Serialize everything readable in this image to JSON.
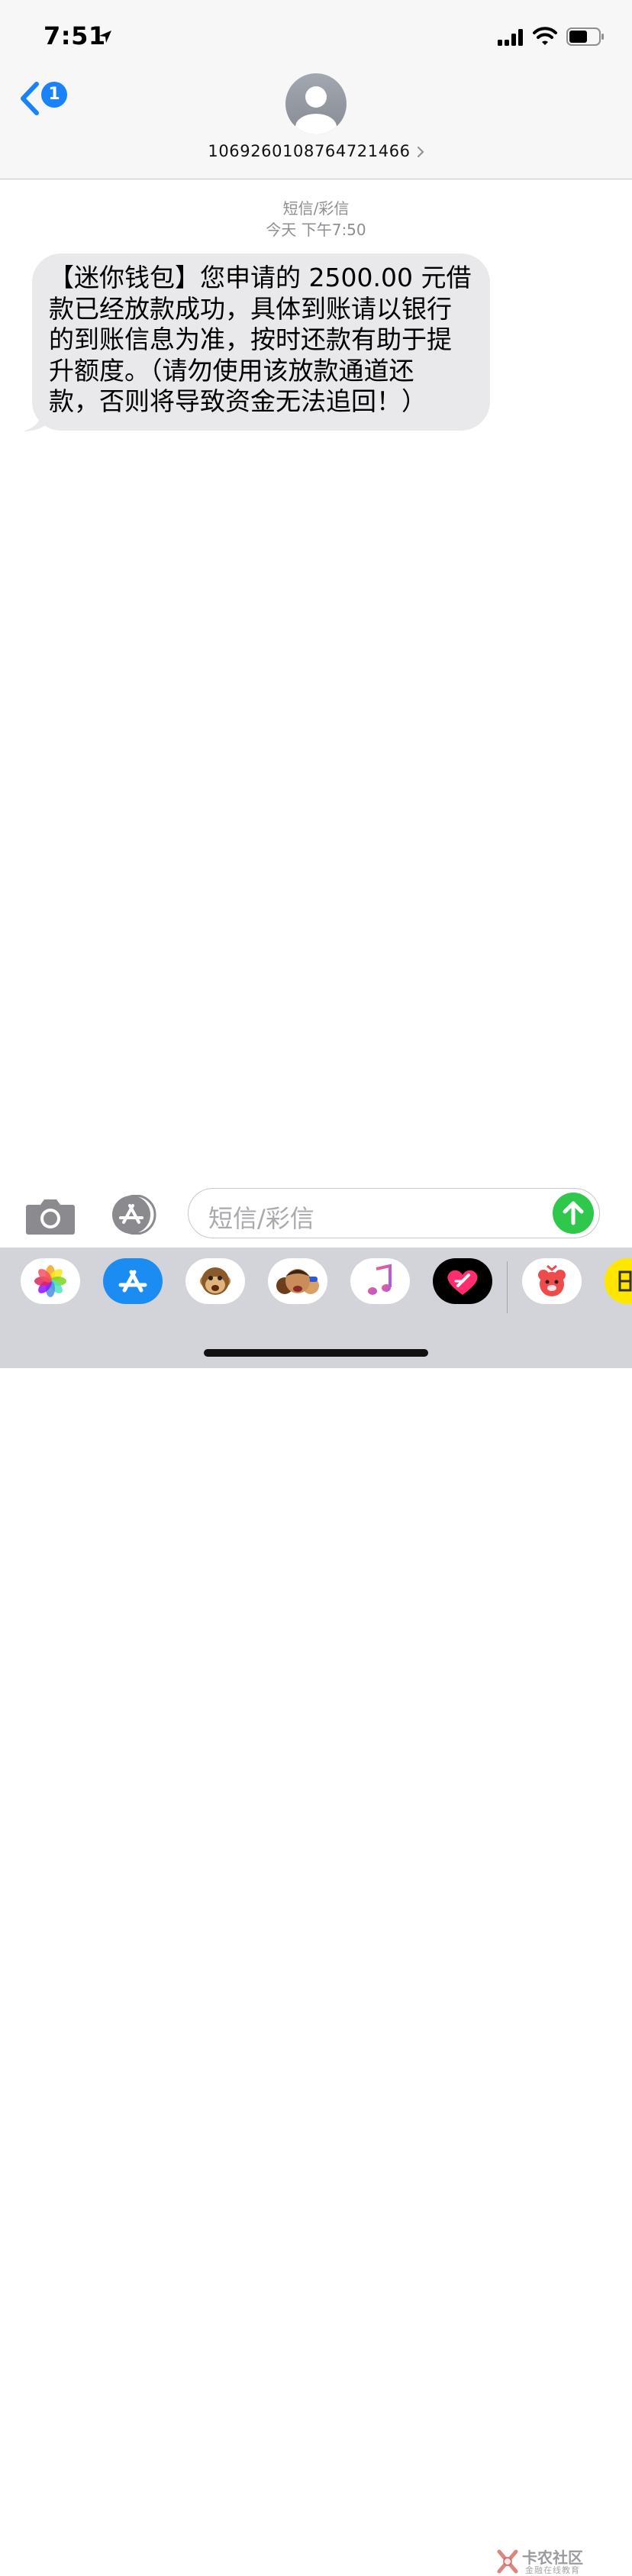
{
  "status_bar": {
    "time": "7:51",
    "battery_level": 0.6
  },
  "nav": {
    "back_badge": "1",
    "contact_number": "1069260108764721466"
  },
  "conversation": {
    "service_label": "短信/彩信",
    "timestamp": "今天 下午7:50",
    "messages": [
      {
        "direction": "incoming",
        "lines": [
          "【迷你钱包】您申请的 2500.00 元借",
          "款已经放款成功，具体到账请以银行",
          "的到账信息为准，按时还款有助于提",
          "升额度。（请勿使用该放款通道还",
          "款，否则将导致资金无法追回！）"
        ]
      }
    ]
  },
  "composer": {
    "placeholder": "短信/彩信"
  },
  "app_drawer": {
    "apps": [
      "photos-icon",
      "app-store-icon",
      "animoji-icon",
      "memoji-icon",
      "music-icon",
      "digital-touch-icon",
      "bear-app-icon",
      "yellow-app-icon"
    ]
  },
  "watermark": {
    "title": "卡农社区",
    "subtitle": "金融在线教育"
  },
  "colors": {
    "ios_blue": "#1a82fb",
    "bubble_gray": "#e9e9eb",
    "send_green": "#2fc84c",
    "drawer_bg": "#d3d4d9"
  }
}
